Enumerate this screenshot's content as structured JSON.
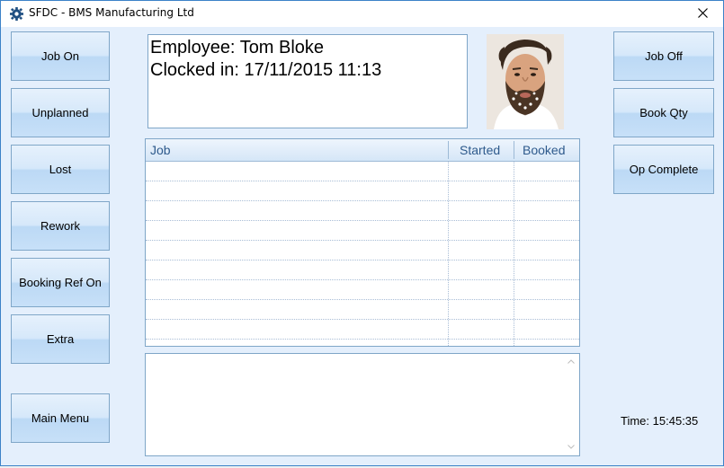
{
  "window": {
    "title": "SFDC - BMS Manufacturing Ltd"
  },
  "left_buttons": {
    "job_on": "Job On",
    "unplanned": "Unplanned",
    "lost": "Lost",
    "rework": "Rework",
    "booking_ref_on": "Booking Ref On",
    "extra": "Extra",
    "main_menu": "Main Menu"
  },
  "right_buttons": {
    "job_off": "Job Off",
    "book_qty": "Book Qty",
    "op_complete": "Op Complete"
  },
  "employee": {
    "name_line": "Employee: Tom Bloke",
    "clocked_line": "Clocked in: 17/11/2015 11:13"
  },
  "grid": {
    "columns": [
      "Job",
      "Started",
      "Booked"
    ],
    "rows": [
      [
        "",
        "",
        ""
      ],
      [
        "",
        "",
        ""
      ],
      [
        "",
        "",
        ""
      ],
      [
        "",
        "",
        ""
      ],
      [
        "",
        "",
        ""
      ],
      [
        "",
        "",
        ""
      ],
      [
        "",
        "",
        ""
      ],
      [
        "",
        "",
        ""
      ],
      [
        "",
        "",
        ""
      ]
    ]
  },
  "notes": {
    "value": ""
  },
  "status": {
    "time_label": "Time:",
    "time_value": "15:45:35"
  },
  "colors": {
    "window_bg": "#e4effc",
    "border": "#3c82c8",
    "header_text": "#2e5a8c"
  },
  "icons": {
    "app": "gear-icon",
    "close": "close-icon"
  }
}
